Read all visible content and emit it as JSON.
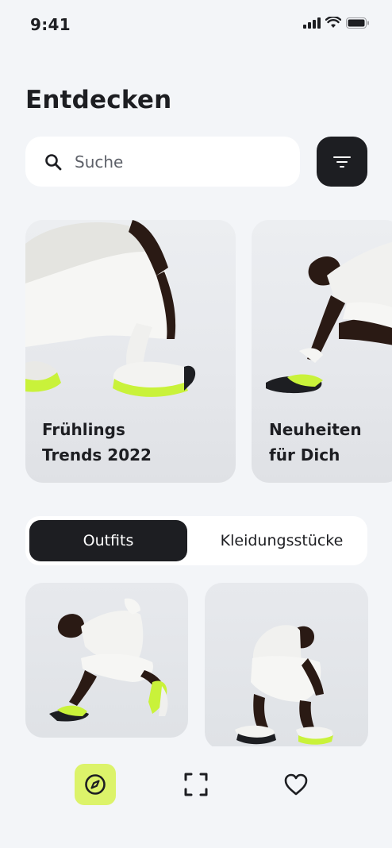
{
  "status_bar": {
    "time": "9:41",
    "icons": [
      "signal-icon",
      "wifi-icon",
      "battery-icon"
    ]
  },
  "header": {
    "title": "Entdecken"
  },
  "search": {
    "placeholder": "Suche",
    "icon": "search-icon"
  },
  "filter": {
    "icon": "filter-icon"
  },
  "featured": [
    {
      "line1": "Frühlings",
      "line2": "Trends 2022"
    },
    {
      "line1": "Neuheiten",
      "line2": "für Dich"
    }
  ],
  "segments": {
    "active": "Outfits",
    "inactive": "Kleidungsstücke"
  },
  "bottom_nav": {
    "items": [
      "compass-icon",
      "scan-icon",
      "heart-icon"
    ],
    "active_color": "#dcf36a"
  },
  "colors": {
    "dark": "#1d1e22",
    "background": "#f3f5f8",
    "accent_neon": "#c9f23a"
  }
}
